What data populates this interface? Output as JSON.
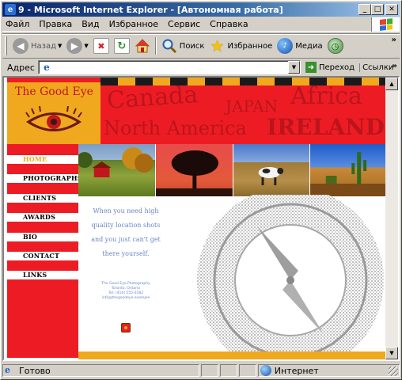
{
  "window": {
    "title": "9 - Microsoft Internet Explorer - [Автономная работа]",
    "minimize": "_",
    "maximize": "□",
    "close": "✕"
  },
  "menu": [
    "Файл",
    "Правка",
    "Вид",
    "Избранное",
    "Сервис",
    "Справка"
  ],
  "toolbar": {
    "back": "Назад",
    "search": "Поиск",
    "favorites": "Избранное",
    "media": "Медиа",
    "more": "»"
  },
  "address": {
    "label": "Адрес",
    "value": "",
    "go": "Переход",
    "links": "Ссылки",
    "more": "»"
  },
  "site": {
    "logo_text": "The Good Eye",
    "banner_words": [
      "Canada",
      "JAPAN",
      "Africa",
      "North America",
      "IRELAND"
    ],
    "nav": [
      "HOME",
      "PHOTOGRAPHS",
      "CLIENTS",
      "AWARDS",
      "BIO",
      "CONTACT",
      "LINKS"
    ],
    "tagline": "When you need high quality location shots and you just can't get there yourself.",
    "contact_lines": [
      "The Good Eye Photography",
      "Toronto, Ontario",
      "Tel: (416) 555-0182",
      "info@thegoodeye.example"
    ],
    "colors": {
      "red": "#ed1c24",
      "orange": "#f0a81e",
      "blue_text": "#6a86c8",
      "compass": "#a8a8a8"
    }
  },
  "status": {
    "text": "Готово",
    "zone": "Интернет"
  }
}
